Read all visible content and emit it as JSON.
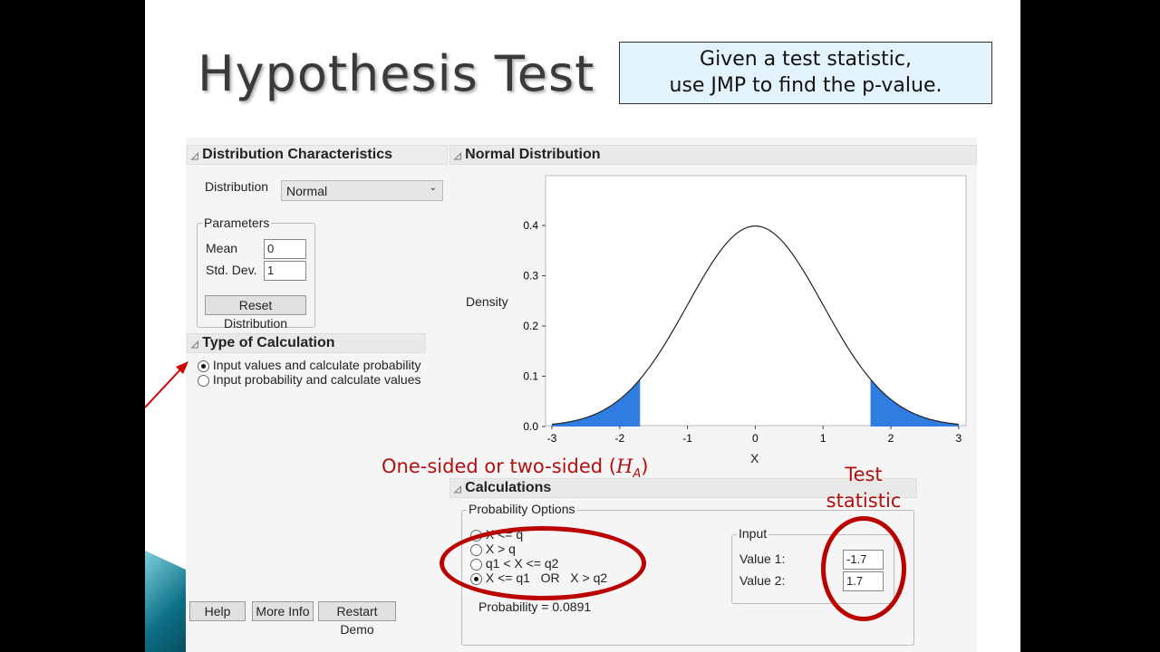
{
  "slide": {
    "title": "Hypothesis Test",
    "note_line1": "Given a test statistic,",
    "note_line2": "use JMP to find the p-value."
  },
  "dist_char": {
    "header": "Distribution Characteristics",
    "distribution_label": "Distribution",
    "distribution_value": "Normal",
    "parameters_label": "Parameters",
    "mean_label": "Mean",
    "mean_value": "0",
    "sd_label": "Std. Dev.",
    "sd_value": "1",
    "reset_label": "Reset Distribution"
  },
  "type_calc": {
    "header": "Type of Calculation",
    "options": [
      "Input values and calculate probability",
      "Input probability and calculate values"
    ],
    "selected": 0
  },
  "plot": {
    "header": "Normal Distribution",
    "ylabel": "Density",
    "xlabel": "X",
    "yticks": [
      "0.0",
      "0.1",
      "0.2",
      "0.3",
      "0.4"
    ],
    "xticks": [
      "-3",
      "-2",
      "-1",
      "0",
      "1",
      "2",
      "3"
    ],
    "fill_color": "#2f7de1"
  },
  "chart_data": {
    "type": "area",
    "curve": "normal pdf",
    "mean": 0,
    "sd": 1,
    "xlim": [
      -3,
      3
    ],
    "ylim": [
      0,
      0.45
    ],
    "shaded": [
      [
        -3,
        -1.7
      ],
      [
        1.7,
        3
      ]
    ],
    "xlabel": "X",
    "ylabel": "Density"
  },
  "calculations": {
    "header": "Calculations",
    "prob_options_label": "Probability Options",
    "options": [
      "X <= q",
      "X > q",
      "q1 < X <= q2",
      "X <= q1   OR   X > q2"
    ],
    "selected": 3,
    "probability": "Probability = 0.0891",
    "input_label": "Input",
    "value1_label": "Value 1:",
    "value1": "-1.7",
    "value2_label": "Value 2:",
    "value2": "1.7"
  },
  "annotations": {
    "sided": "One-sided or two-sided (",
    "sided_h": "H",
    "sided_sub": "A",
    "sided_end": ")",
    "test_stat_1": "Test",
    "test_stat_2": "statistic"
  },
  "buttons": {
    "help": "Help",
    "more_info": "More Info",
    "restart": "Restart Demo"
  }
}
